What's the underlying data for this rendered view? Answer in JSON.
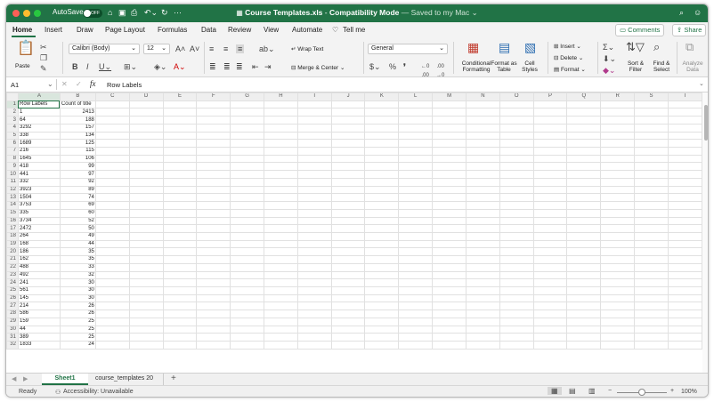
{
  "window": {
    "autosave_label": "AutoSave",
    "autosave_state": "OFF",
    "file_name": "Course Templates.xls",
    "separator": "  -  ",
    "compat_mode": "Compatibility Mode",
    "saved_status": "— Saved to my Mac ⌄"
  },
  "ribbon_tabs": {
    "home": "Home",
    "insert": "Insert",
    "draw": "Draw",
    "page_layout": "Page Layout",
    "formulas": "Formulas",
    "data": "Data",
    "review": "Review",
    "view": "View",
    "automate": "Automate",
    "tell_me": "Tell me"
  },
  "ribbon_buttons": {
    "comments": "Comments",
    "share": "Share",
    "paste": "Paste",
    "font_name": "Calibri (Body)",
    "font_size": "12",
    "wrap_text": "Wrap Text",
    "merge_center": "Merge & Center",
    "number_format": "General",
    "conditional_formatting": "Conditional Formatting",
    "format_as_table": "Format as Table",
    "cell_styles": "Cell Styles",
    "insert": "Insert",
    "delete": "Delete",
    "format": "Format",
    "sort_filter": "Sort & Filter",
    "find_select": "Find & Select",
    "analyze_data": "Analyze Data"
  },
  "formula_bar": {
    "name_box": "A1",
    "fx": "fx",
    "content": "Row Labels"
  },
  "columns": [
    "A",
    "B",
    "C",
    "D",
    "E",
    "F",
    "G",
    "H",
    "I",
    "J",
    "K",
    "L",
    "M",
    "N",
    "O",
    "P",
    "Q",
    "R",
    "S",
    "T"
  ],
  "rows": [
    [
      "Row Labels",
      "Count of title"
    ],
    [
      "1",
      "2413"
    ],
    [
      "64",
      "188"
    ],
    [
      "3292",
      "157"
    ],
    [
      "338",
      "134"
    ],
    [
      "1689",
      "125"
    ],
    [
      "216",
      "115"
    ],
    [
      "1645",
      "106"
    ],
    [
      "418",
      "99"
    ],
    [
      "441",
      "97"
    ],
    [
      "332",
      "92"
    ],
    [
      "3923",
      "89"
    ],
    [
      "1504",
      "74"
    ],
    [
      "3753",
      "69"
    ],
    [
      "335",
      "60"
    ],
    [
      "3734",
      "52"
    ],
    [
      "2472",
      "50"
    ],
    [
      "264",
      "49"
    ],
    [
      "168",
      "44"
    ],
    [
      "186",
      "35"
    ],
    [
      "162",
      "35"
    ],
    [
      "488",
      "33"
    ],
    [
      "492",
      "32"
    ],
    [
      "241",
      "30"
    ],
    [
      "561",
      "30"
    ],
    [
      "145",
      "30"
    ],
    [
      "214",
      "26"
    ],
    [
      "586",
      "26"
    ],
    [
      "159",
      "25"
    ],
    [
      "44",
      "25"
    ],
    [
      "389",
      "25"
    ],
    [
      "1833",
      "24"
    ]
  ],
  "sheets": {
    "active": "Sheet1",
    "other": "course_templates 20",
    "add": "+"
  },
  "status": {
    "ready": "Ready",
    "accessibility": "Accessibility: Unavailable",
    "zoom": "100%"
  }
}
